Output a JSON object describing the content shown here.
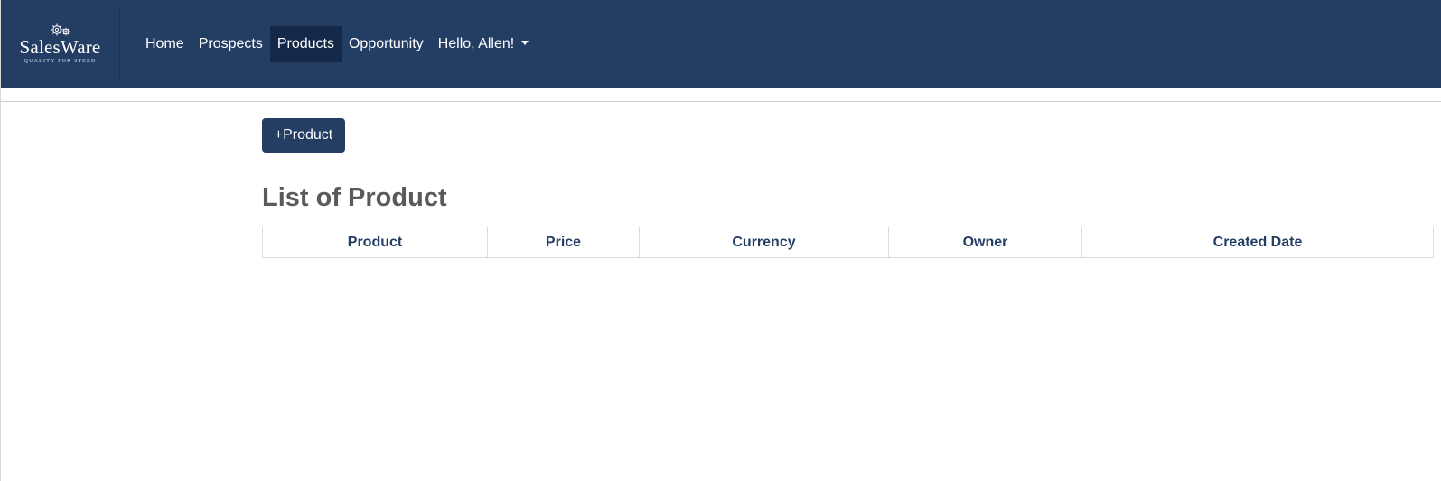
{
  "brand": {
    "name": "SalesWare",
    "tagline": "QUALITY FOR SPEED"
  },
  "nav": {
    "items": [
      {
        "label": "Home"
      },
      {
        "label": "Prospects"
      },
      {
        "label": "Products",
        "active": true
      },
      {
        "label": "Opportunity"
      }
    ],
    "user_menu": "Hello, Allen!"
  },
  "toolbar": {
    "add_product_label": "+Product"
  },
  "main": {
    "title": "List of Product",
    "table": {
      "columns": [
        "Product",
        "Price",
        "Currency",
        "Owner",
        "Created Date"
      ],
      "rows": []
    }
  },
  "colors": {
    "navbar": "#233d63",
    "active_nav": "#14284a",
    "header_text": "#233d63",
    "title_text": "#5a5a5a"
  }
}
